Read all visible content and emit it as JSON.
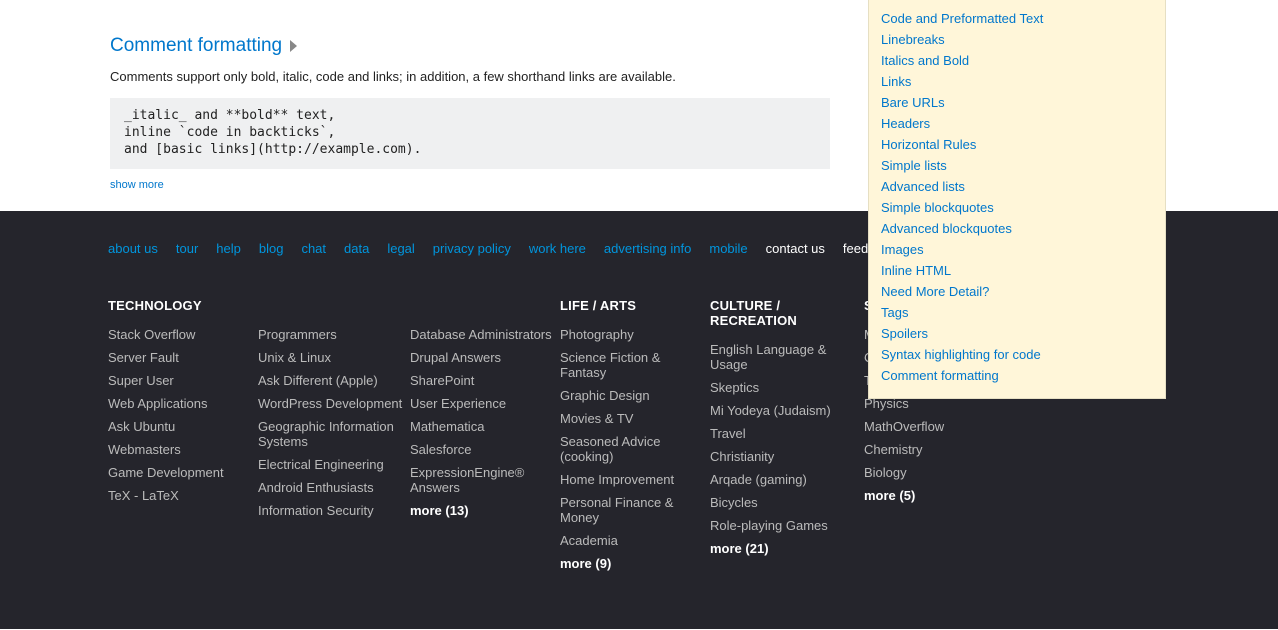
{
  "main": {
    "heading": "Comment formatting",
    "desc": "Comments support only bold, italic, code and links; in addition, a few shorthand links are available.",
    "code": "_italic_ and **bold** text,\ninline `code in backticks`,\nand [basic links](http://example.com).",
    "showmore": "show more"
  },
  "footer": {
    "links": [
      "about us",
      "tour",
      "help",
      "blog",
      "chat",
      "data",
      "legal",
      "privacy policy",
      "work here",
      "advertising info",
      "mobile"
    ],
    "links_white": [
      "contact us",
      "feedback"
    ],
    "tech_h": "TECHNOLOGY",
    "tech1": [
      "Stack Overflow",
      "Server Fault",
      "Super User",
      "Web Applications",
      "Ask Ubuntu",
      "Webmasters",
      "Game Development",
      "TeX - LaTeX"
    ],
    "tech2": [
      "Programmers",
      "Unix & Linux",
      "Ask Different (Apple)",
      "WordPress Development",
      "Geographic Information Systems",
      "Electrical Engineering",
      "Android Enthusiasts",
      "Information Security"
    ],
    "tech3": [
      "Database Administrators",
      "Drupal Answers",
      "SharePoint",
      "User Experience",
      "Mathematica",
      "Salesforce",
      "ExpressionEngine® Answers"
    ],
    "tech3_more": "more (13)",
    "life_h": "LIFE / ARTS",
    "life": [
      "Photography",
      "Science Fiction & Fantasy",
      "Graphic Design",
      "Movies & TV",
      "Seasoned Advice (cooking)",
      "Home Improvement",
      "Personal Finance & Money",
      "Academia"
    ],
    "life_more": "more (9)",
    "cult_h": "CULTURE / RECREATION",
    "cult": [
      "English Language & Usage",
      "Skeptics",
      "Mi Yodeya (Judaism)",
      "Travel",
      "Christianity",
      "Arqade (gaming)",
      "Bicycles",
      "Role-playing Games"
    ],
    "cult_more": "more (21)",
    "sci_h": "SCIENCE",
    "sci": [
      "Mathematics",
      "Cross Validated (stats)",
      "Theoretical Computer Science",
      "Physics",
      "MathOverflow",
      "Chemistry",
      "Biology"
    ],
    "sci_more": "more (5)"
  },
  "sidebar": [
    "Code and Preformatted Text",
    "Linebreaks",
    "Italics and Bold",
    "Links",
    "Bare URLs",
    "Headers",
    "Horizontal Rules",
    "Simple lists",
    "Advanced lists",
    "Simple blockquotes",
    "Advanced blockquotes",
    "Images",
    "Inline HTML",
    "Need More Detail?",
    "Tags",
    "Spoilers",
    "Syntax highlighting for code",
    "Comment formatting"
  ]
}
